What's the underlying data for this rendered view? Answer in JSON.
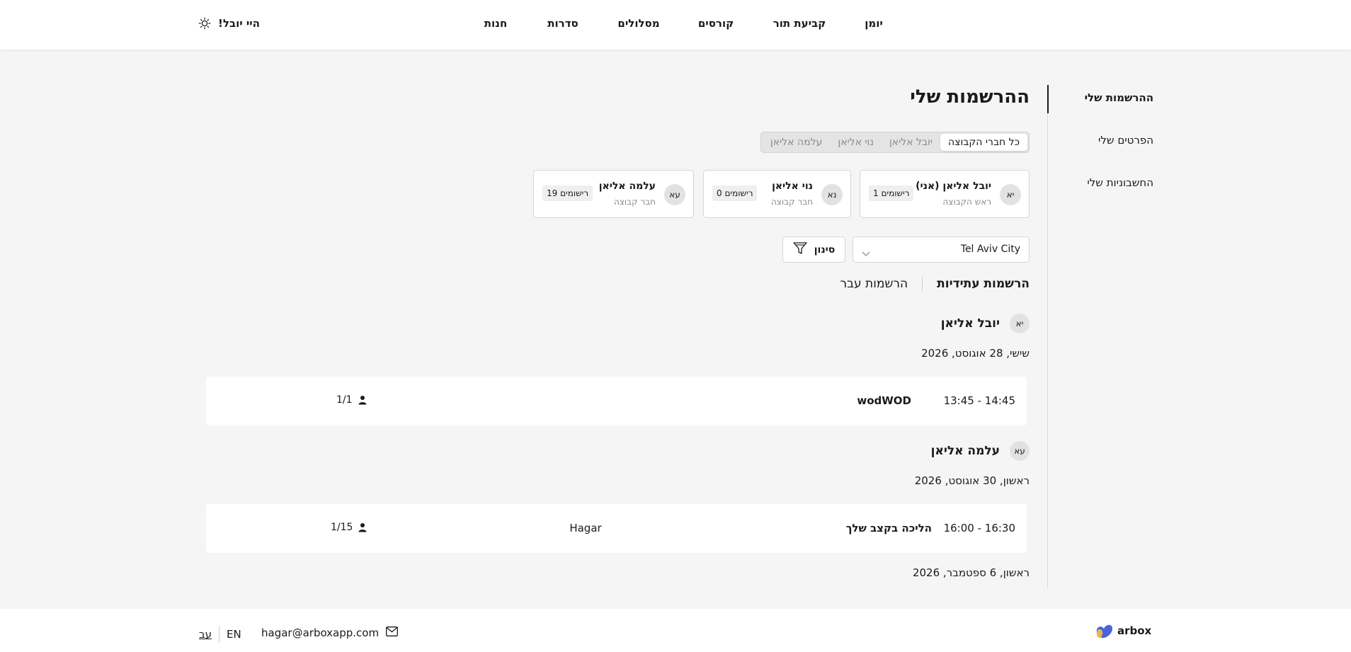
{
  "nav": {
    "items": [
      "יומן",
      "קביעת תור",
      "קורסים",
      "מסלולים",
      "סדרות",
      "חנות"
    ],
    "greeting": "היי יובל!"
  },
  "sidebar": {
    "items": [
      "ההרשמות שלי",
      "הפרטים שלי",
      "החשבוניות שלי"
    ]
  },
  "page": {
    "title": "ההרשמות שלי"
  },
  "member_tabs": [
    "כל חברי הקבוצה",
    "יובל אליאן",
    "נוי אליאן",
    "עלמה אליאן"
  ],
  "member_cards": [
    {
      "initials": "יא",
      "name": "יובל אליאן (אני)",
      "role": "ראש הקבוצה",
      "count": "1 רישומים"
    },
    {
      "initials": "נא",
      "name": "נוי אליאן",
      "role": "חבר קבוצה",
      "count": "0 רישומים"
    },
    {
      "initials": "עא",
      "name": "עלמה אליאן",
      "role": "חבר קבוצה",
      "count": "19 רישומים"
    }
  ],
  "filters": {
    "location": "Tel Aviv City",
    "filter_label": "סינון"
  },
  "view_tabs": {
    "future": "הרשמות עתידיות",
    "past": "הרשמות עבר"
  },
  "groups": [
    {
      "initials": "יא",
      "name": "יובל אליאן",
      "date": "שישי, 28 אוגוסט, 2026",
      "row": {
        "time": "13:45 - 14:45",
        "name": "wodWOD",
        "coach": "",
        "capacity": "1/1"
      }
    },
    {
      "initials": "עא",
      "name": "עלמה אליאן",
      "date": "ראשון, 30 אוגוסט, 2026",
      "row": {
        "time": "16:00 - 16:30",
        "name": "הליכה בקצב שלך",
        "coach": "Hagar",
        "capacity": "1/15"
      }
    }
  ],
  "next_date": "ראשון, 6 ספטמבר, 2026",
  "footer": {
    "lang_he": "עב",
    "lang_en": "EN",
    "email": "hagar@arboxapp.com",
    "logo_text": "arbox"
  },
  "colors": {
    "background": "#f5f5f5",
    "text": "#1a1a1a",
    "muted": "#8a8a8a",
    "logo_blue": "#4a63d8",
    "logo_yellow": "#f0c040"
  },
  "icons": {
    "theme": "sun-icon",
    "filter": "filter-icon",
    "dropdown": "chevron-down-icon",
    "capacity": "person-icon",
    "email": "mail-icon",
    "logo": "arbox-logo-icon"
  }
}
